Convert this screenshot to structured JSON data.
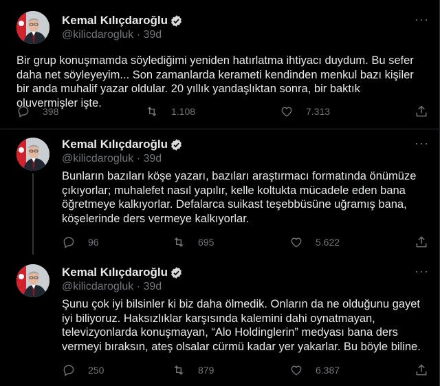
{
  "colors": {
    "background": "#000000",
    "text": "#e7e9ea",
    "muted": "#71767b",
    "verified": "#d9d9d9"
  },
  "tweets": [
    {
      "name": "Kemal Kılıçdaroğlu",
      "handle": "@kilicdarogluk",
      "time": "· 39d",
      "text": "Bir grup konuşmamda söylediğimi yeniden hatırlatma ihtiyacı duydum. Bu sefer daha net söyleyeyim... Son zamanlarda kerameti kendinden menkul bazı kişiler bir anda muhalif yazar oldular. 20 yıllık yandaşlıktan sonra, bir baktık oluvermişler işte.",
      "replies": "398",
      "retweets": "1.108",
      "likes": "7.313"
    },
    {
      "name": "Kemal Kılıçdaroğlu",
      "handle": "@kilicdarogluk",
      "time": "· 39d",
      "text": "Bunların bazıları köşe yazarı, bazıları araştırmacı formatında önümüze çıkıyorlar; muhalefet nasıl yapılır, kelle koltukta mücadele eden bana öğretmeye kalkıyorlar. Defalarca suikast teşebbüsüne uğramış bana, köşelerinde ders vermeye kalkıyorlar.",
      "replies": "96",
      "retweets": "695",
      "likes": "5.622"
    },
    {
      "name": "Kemal Kılıçdaroğlu",
      "handle": "@kilicdarogluk",
      "time": "· 39d",
      "text": "Şunu çok iyi bilsinler ki biz daha ölmedik. Onların da ne olduğunu gayet iyi biliyoruz. Haksızlıklar karşısında kalemini dahi oynatmayan, televizyonlarda konuşmayan, “Alo Holdinglerin” medyası bana ders vermeyi bıraksın, ateş olsalar cürmü kadar yer yakarlar. Bu böyle biline.",
      "replies": "250",
      "retweets": "879",
      "likes": "6.387"
    }
  ],
  "icons": [
    "reply-icon",
    "retweet-icon",
    "like-icon",
    "share-icon",
    "verified-icon",
    "more-icon"
  ]
}
